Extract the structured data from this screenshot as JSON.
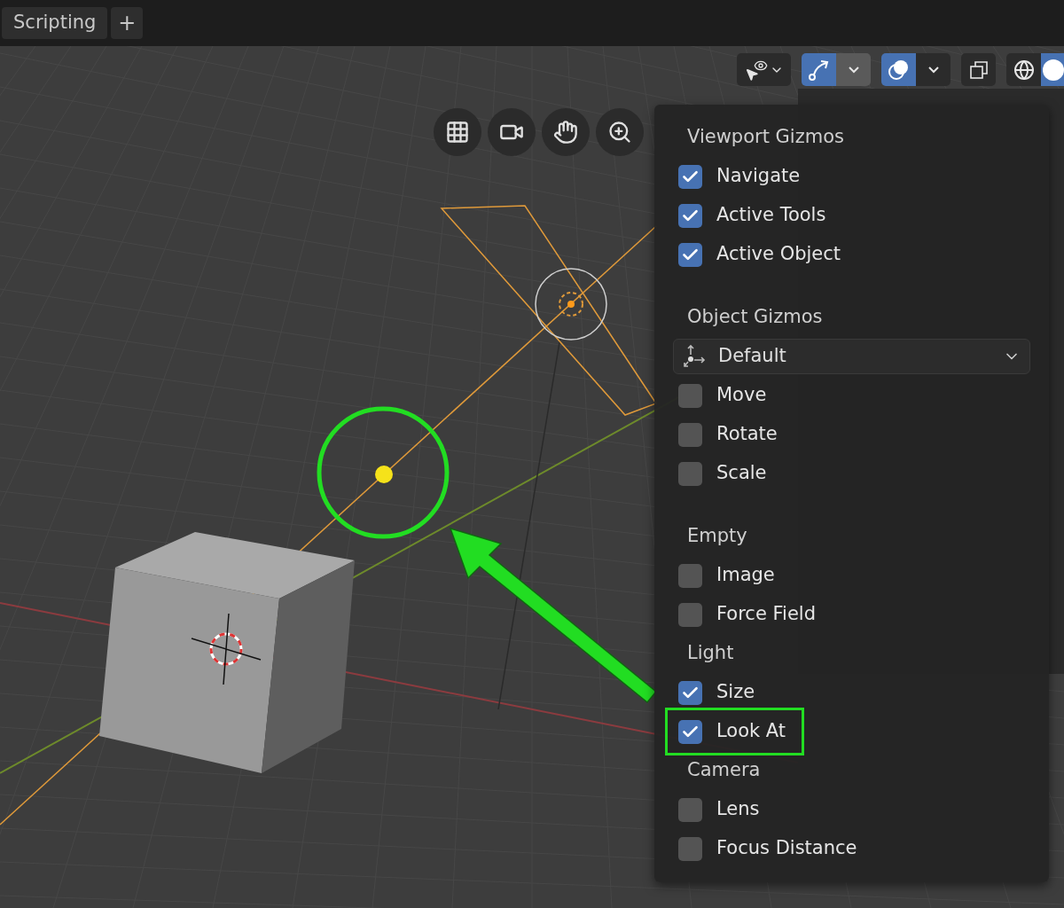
{
  "workspace_tabs": [
    {
      "label": "Scripting",
      "selected": true
    }
  ],
  "add_tab_button": "+",
  "header_buttons": [
    {
      "kind": "visibility",
      "selected": false
    },
    {
      "kind": "gizmo-toggle",
      "selected": true
    },
    {
      "kind": "gizmo-menu",
      "open": true
    },
    {
      "kind": "overlay-toggle",
      "selected": true
    },
    {
      "kind": "overlay-menu",
      "open": false
    },
    {
      "kind": "xray",
      "selected": false
    },
    {
      "kind": "wireframe",
      "selected": false
    },
    {
      "kind": "solid",
      "selected": true
    }
  ],
  "navigation_gizmos": [
    {
      "kind": "grid"
    },
    {
      "kind": "camera"
    },
    {
      "kind": "hand"
    },
    {
      "kind": "zoom"
    }
  ],
  "gizmos_menu": {
    "entries": [
      {
        "kind": "heading",
        "label": "Viewport Gizmos",
        "spaced": false
      },
      {
        "kind": "checkbox",
        "label": "Navigate",
        "checked": true,
        "highlighted": false
      },
      {
        "kind": "checkbox",
        "label": "Active Tools",
        "checked": true,
        "highlighted": false
      },
      {
        "kind": "checkbox",
        "label": "Active Object",
        "checked": true,
        "highlighted": false
      },
      {
        "kind": "heading",
        "label": "Object Gizmos",
        "spaced": true
      },
      {
        "kind": "dropdown",
        "label": "Default"
      },
      {
        "kind": "checkbox",
        "label": "Move",
        "checked": false,
        "highlighted": false
      },
      {
        "kind": "checkbox",
        "label": "Rotate",
        "checked": false,
        "highlighted": false
      },
      {
        "kind": "checkbox",
        "label": "Scale",
        "checked": false,
        "highlighted": false
      },
      {
        "kind": "heading",
        "label": "Empty",
        "spaced": true
      },
      {
        "kind": "checkbox",
        "label": "Image",
        "checked": false,
        "highlighted": false
      },
      {
        "kind": "checkbox",
        "label": "Force Field",
        "checked": false,
        "highlighted": false
      },
      {
        "kind": "heading",
        "label": "Light",
        "spaced": false
      },
      {
        "kind": "checkbox",
        "label": "Size",
        "checked": true,
        "highlighted": false
      },
      {
        "kind": "checkbox",
        "label": "Look At",
        "checked": true,
        "highlighted": true
      },
      {
        "kind": "heading",
        "label": "Camera",
        "spaced": false
      },
      {
        "kind": "checkbox",
        "label": "Lens",
        "checked": false,
        "highlighted": false
      },
      {
        "kind": "checkbox",
        "label": "Focus Distance",
        "checked": false,
        "highlighted": false
      }
    ]
  }
}
